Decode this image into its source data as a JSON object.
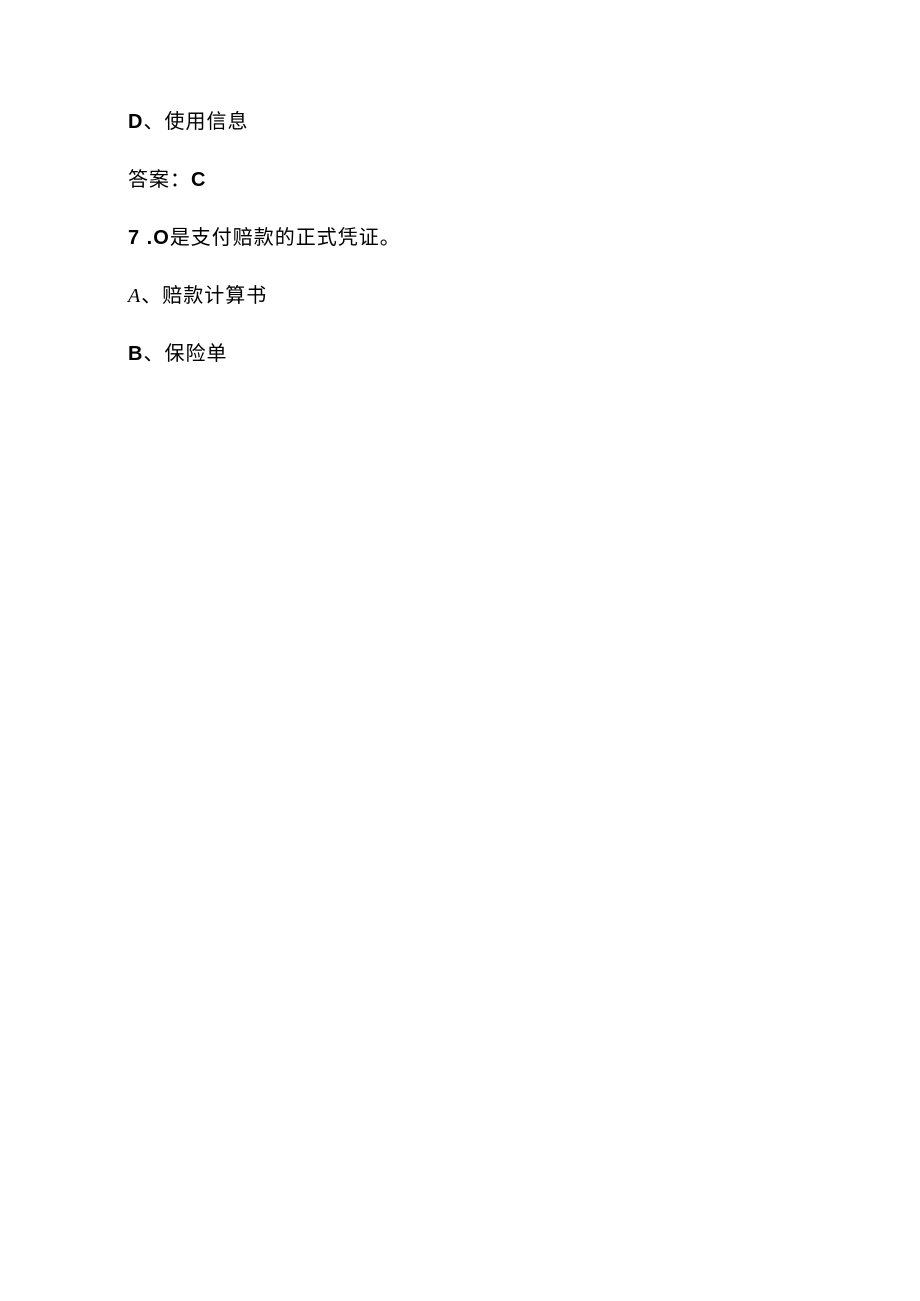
{
  "q6_option_d": {
    "letter": "D",
    "sep": "、",
    "text": "使用信息"
  },
  "q6_answer": {
    "label": "答案：",
    "value": "C"
  },
  "q7": {
    "number": "7",
    "dot": " .",
    "blank": "O",
    "stem": "是支付赔款的正式凭证。"
  },
  "q7_option_a": {
    "letter": "A",
    "sep": "、",
    "text": "赔款计算书"
  },
  "q7_option_b": {
    "letter": "B",
    "sep": "、",
    "text": "保险单"
  }
}
